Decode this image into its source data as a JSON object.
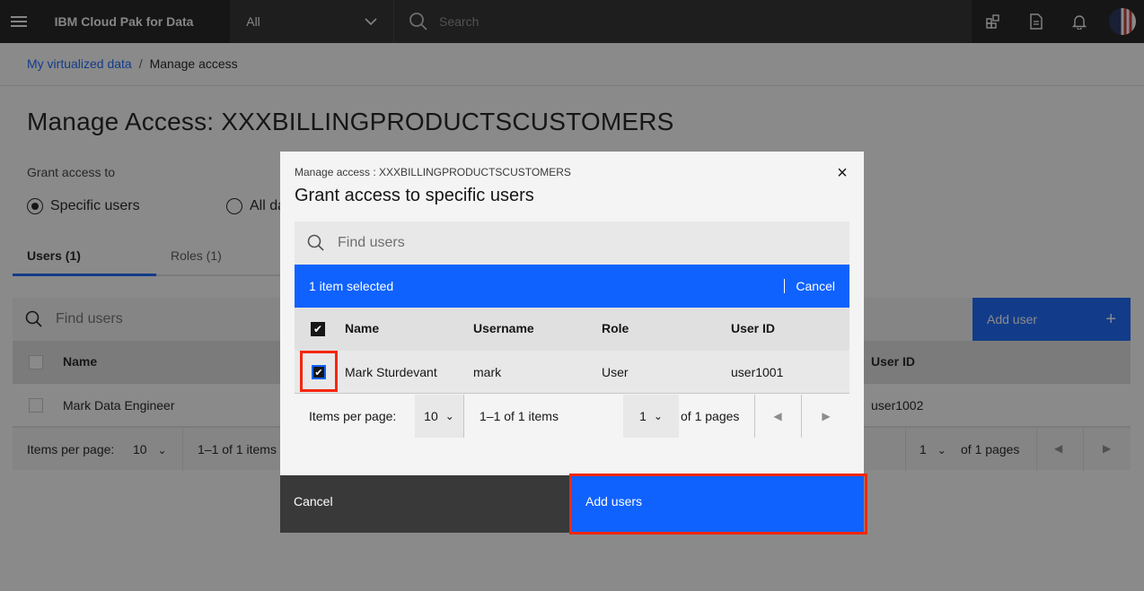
{
  "header": {
    "product_name": "IBM Cloud Pak for Data",
    "scope_value": "All",
    "search_placeholder": "Search"
  },
  "breadcrumb": {
    "link": "My virtualized data",
    "separator": "/",
    "current": "Manage access"
  },
  "page": {
    "title": "Manage Access: XXXBILLINGPRODUCTSCUSTOMERS",
    "grant_label": "Grant access to",
    "radio_specific": "Specific users",
    "radio_all": "All data",
    "tabs": [
      {
        "label": "Users (1)"
      },
      {
        "label": "Roles (1)"
      }
    ],
    "find_placeholder": "Find users",
    "add_user_label": "Add user",
    "add_icon": "+",
    "table_headers": {
      "name": "Name",
      "user_id": "User ID"
    },
    "rows": [
      {
        "name": "Mark Data Engineer",
        "user_id": "user1002"
      }
    ],
    "pager": {
      "items_per_page_label": "Items per page:",
      "items_per_page": "10",
      "range": "1–1 of 1 items",
      "page": "1",
      "of_pages": "of 1 pages"
    }
  },
  "modal": {
    "label": "Manage access : XXXBILLINGPRODUCTSCUSTOMERS",
    "title": "Grant access to specific users",
    "close_icon": "×",
    "search_placeholder": "Find users",
    "batch_text": "1 item selected",
    "batch_cancel": "Cancel",
    "headers": {
      "name": "Name",
      "username": "Username",
      "role": "Role",
      "user_id": "User ID"
    },
    "rows": [
      {
        "name": "Mark Sturdevant",
        "username": "mark",
        "role": "User",
        "user_id": "user1001",
        "checked": true
      }
    ],
    "pager": {
      "items_per_page_label": "Items per page:",
      "items_per_page": "10",
      "range": "1–1 of 1 items",
      "page": "1",
      "of_pages": "of 1 pages"
    },
    "cancel_button": "Cancel",
    "primary_button": "Add users"
  },
  "colors": {
    "primary": "#0f62fe",
    "header_bg": "#161616",
    "highlight": "#f5260f"
  }
}
